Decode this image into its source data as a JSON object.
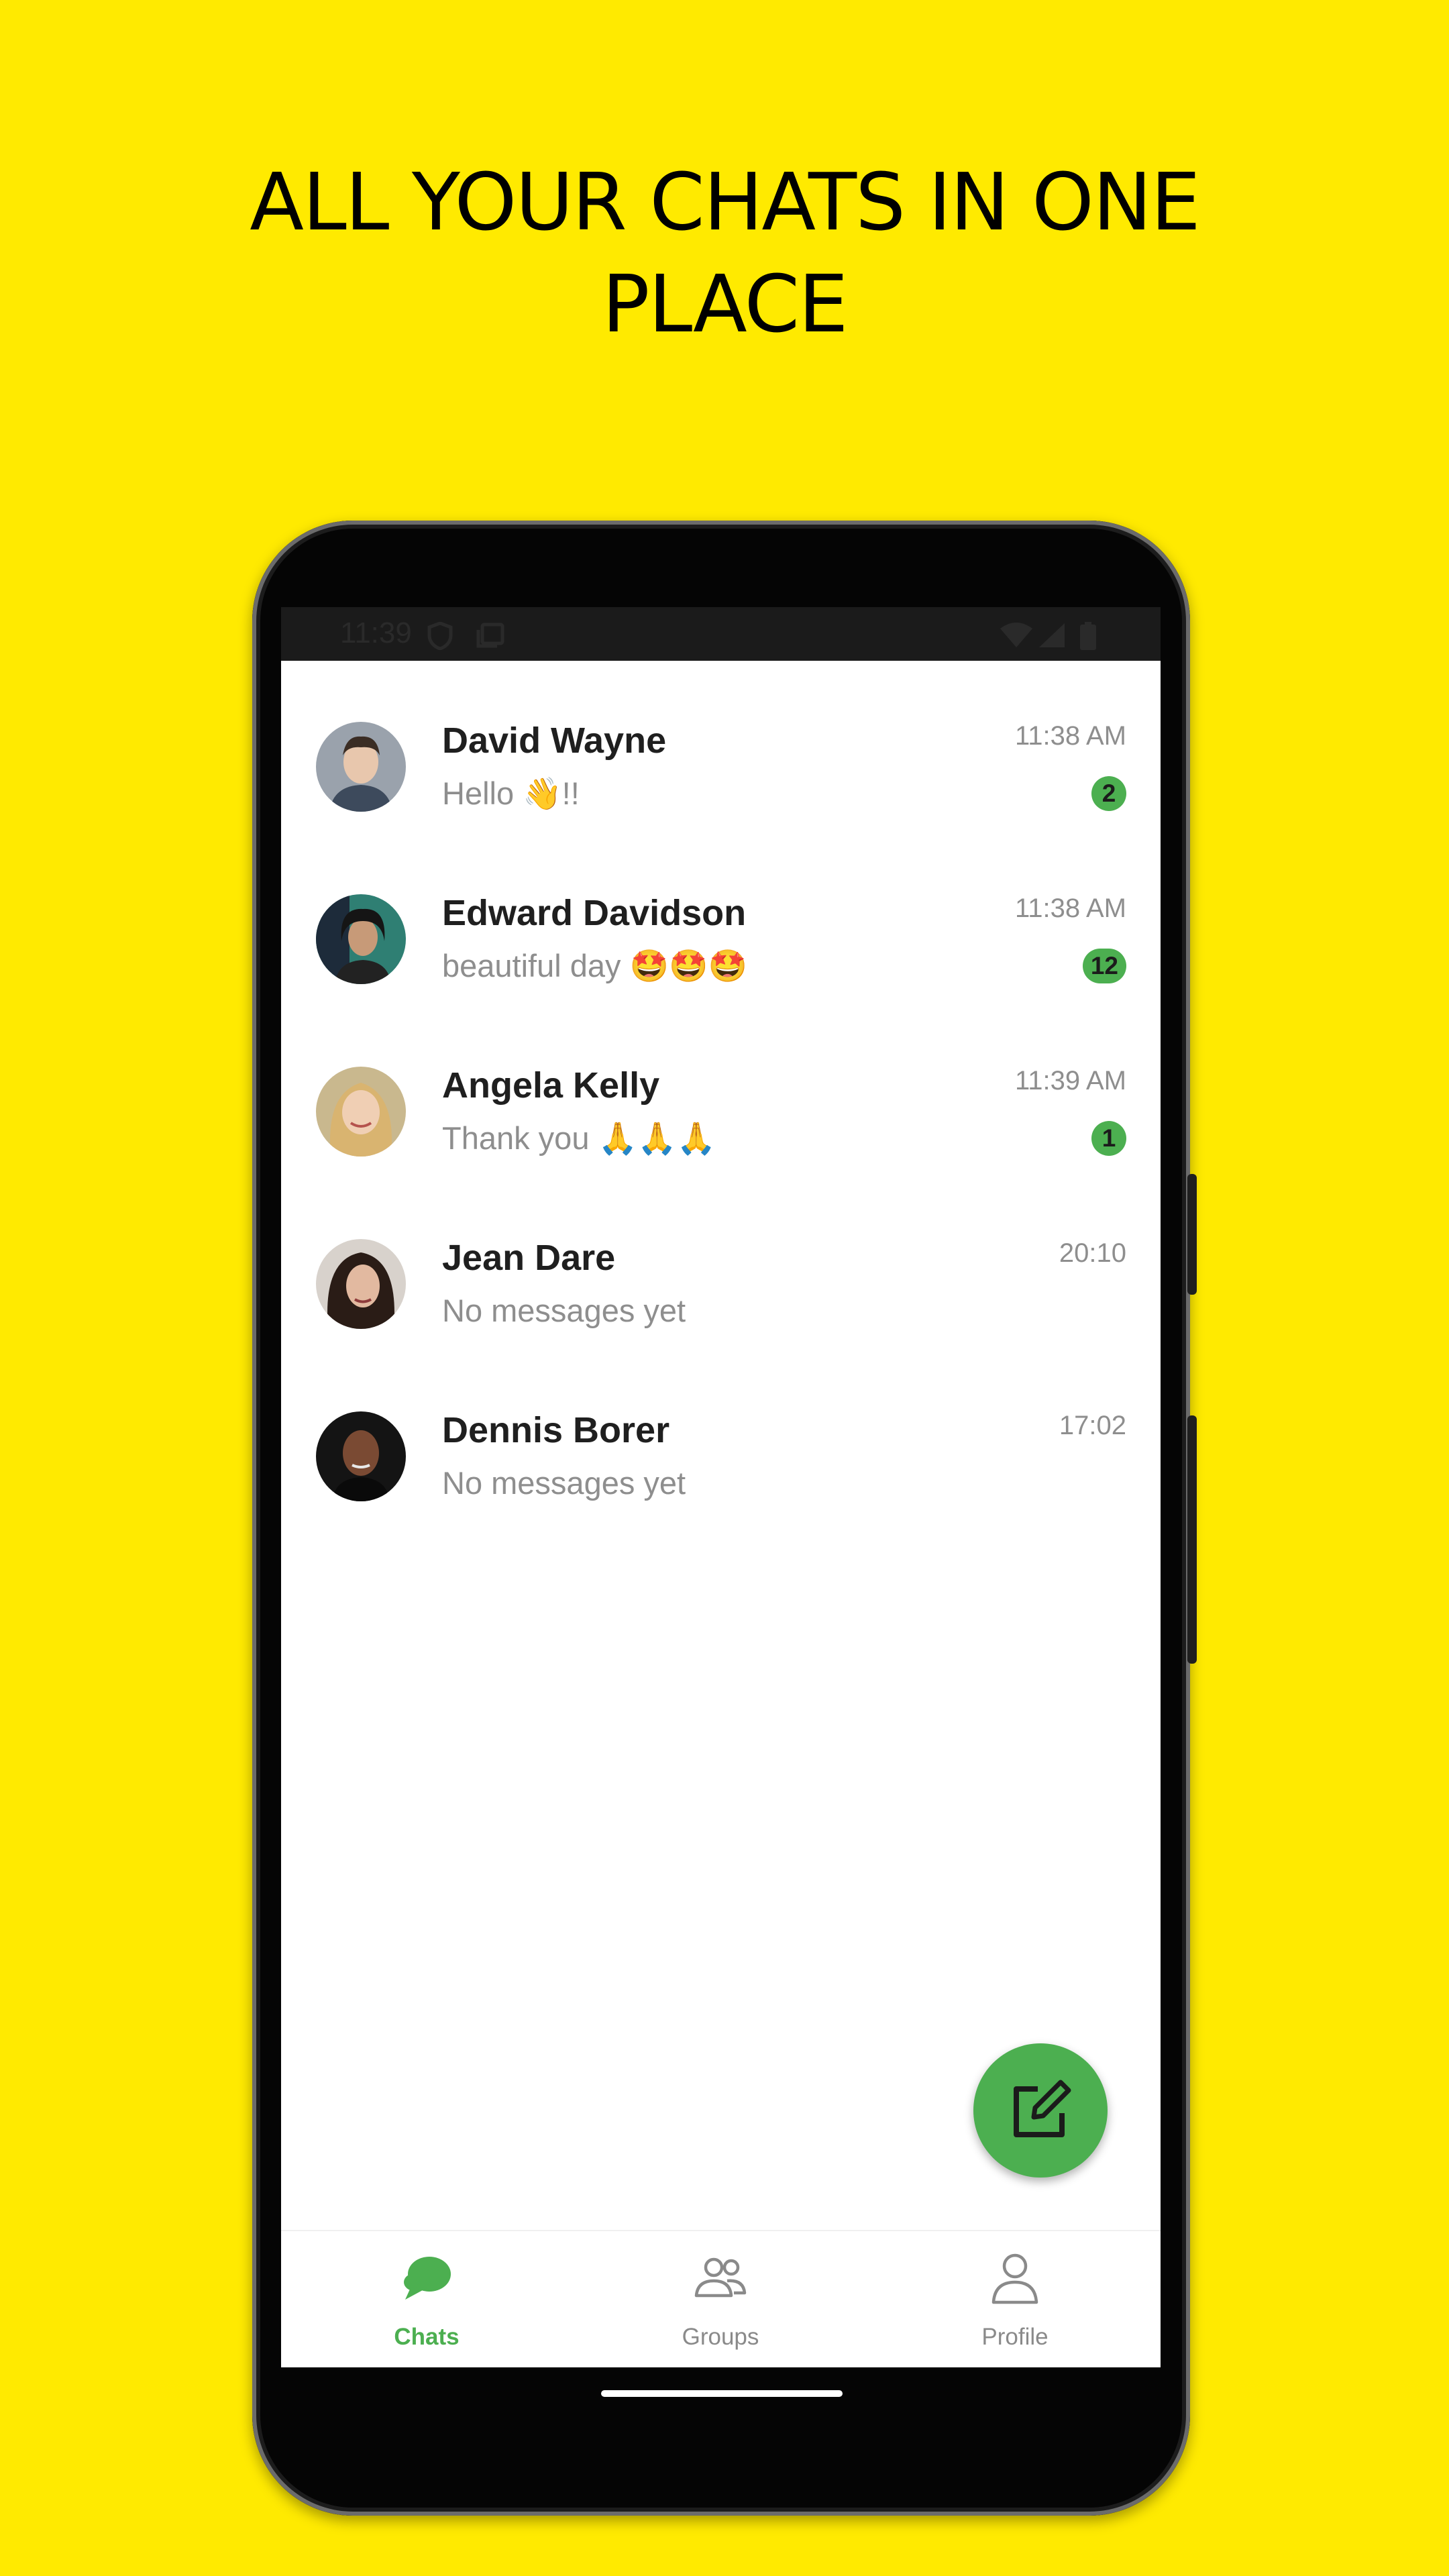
{
  "headline": {
    "line1": "ALL YOUR CHATS IN ONE",
    "line2": "PLACE"
  },
  "status_bar": {
    "time": "11:39"
  },
  "chats": [
    {
      "name": "David Wayne",
      "message": "Hello 👋!!",
      "time": "11:38 AM",
      "unread": "2"
    },
    {
      "name": "Edward Davidson",
      "message": "beautiful day 🤩🤩🤩",
      "time": "11:38 AM",
      "unread": "12"
    },
    {
      "name": "Angela Kelly",
      "message": "Thank you 🙏🙏🙏",
      "time": "11:39 AM",
      "unread": "1"
    },
    {
      "name": "Jean Dare",
      "message": "No messages yet",
      "time": "20:10",
      "unread": ""
    },
    {
      "name": "Dennis Borer",
      "message": "No messages yet",
      "time": "17:02",
      "unread": ""
    }
  ],
  "fab": {
    "icon": "compose-icon"
  },
  "bottom_nav": {
    "items": [
      {
        "label": "Chats",
        "icon": "chat-bubbles-icon",
        "active": true
      },
      {
        "label": "Groups",
        "icon": "people-icon",
        "active": false
      },
      {
        "label": "Profile",
        "icon": "person-icon",
        "active": false
      }
    ]
  },
  "colors": {
    "background": "#FFEA00",
    "accent": "#4CAF50",
    "name_text": "#1F1F1F",
    "secondary_text": "#8E8E8E"
  }
}
